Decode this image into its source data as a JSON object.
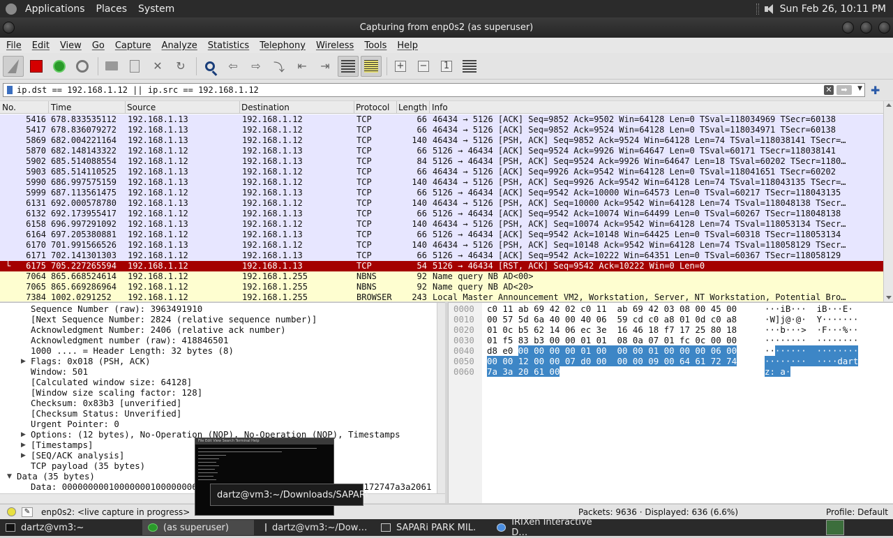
{
  "top_panel": {
    "menus": [
      "Applications",
      "Places",
      "System"
    ],
    "clock": "Sun Feb 26, 10:11 PM"
  },
  "window": {
    "title": "Capturing from enp0s2 (as superuser)"
  },
  "menubar": [
    "File",
    "Edit",
    "View",
    "Go",
    "Capture",
    "Analyze",
    "Statistics",
    "Telephony",
    "Wireless",
    "Tools",
    "Help"
  ],
  "toolbar_icons": [
    "shark-fin-start-icon",
    "stop-square-icon",
    "restart-fin-icon",
    "capture-options-gear-icon",
    "open-folder-icon",
    "save-file-icon",
    "close-file-icon",
    "reload-icon",
    "find-packet-icon",
    "go-back-icon",
    "go-forward-icon",
    "go-to-packet-icon",
    "go-first-icon",
    "go-last-icon",
    "autoscroll-icon",
    "colorize-icon",
    "zoom-in-icon",
    "zoom-out-icon",
    "normal-size-icon",
    "resize-columns-icon"
  ],
  "filter": {
    "value": "ip.dst == 192.168.1.12 || ip.src == 192.168.1.12"
  },
  "packet_list": {
    "columns": [
      "No.",
      "Time",
      "Source",
      "Destination",
      "Protocol",
      "Length",
      "Info"
    ],
    "rows": [
      {
        "no": "5416",
        "time": "678.833535112",
        "src": "192.168.1.13",
        "dst": "192.168.1.12",
        "proto": "TCP",
        "len": "66",
        "info": "46434 → 5126 [ACK] Seq=9852 Ack=9502 Win=64128 Len=0 TSval=118034969 TSecr=60138",
        "kind": "tcp"
      },
      {
        "no": "5417",
        "time": "678.836079272",
        "src": "192.168.1.13",
        "dst": "192.168.1.12",
        "proto": "TCP",
        "len": "66",
        "info": "46434 → 5126 [ACK] Seq=9852 Ack=9524 Win=64128 Len=0 TSval=118034971 TSecr=60138",
        "kind": "tcp"
      },
      {
        "no": "5869",
        "time": "682.004221164",
        "src": "192.168.1.13",
        "dst": "192.168.1.12",
        "proto": "TCP",
        "len": "140",
        "info": "46434 → 5126 [PSH, ACK] Seq=9852 Ack=9524 Win=64128 Len=74 TSval=118038141 TSecr=…",
        "kind": "tcp"
      },
      {
        "no": "5870",
        "time": "682.148143322",
        "src": "192.168.1.12",
        "dst": "192.168.1.13",
        "proto": "TCP",
        "len": "66",
        "info": "5126 → 46434 [ACK] Seq=9524 Ack=9926 Win=64647 Len=0 TSval=60171 TSecr=118038141",
        "kind": "tcp"
      },
      {
        "no": "5902",
        "time": "685.514088554",
        "src": "192.168.1.12",
        "dst": "192.168.1.13",
        "proto": "TCP",
        "len": "84",
        "info": "5126 → 46434 [PSH, ACK] Seq=9524 Ack=9926 Win=64647 Len=18 TSval=60202 TSecr=1180…",
        "kind": "tcp"
      },
      {
        "no": "5903",
        "time": "685.514110525",
        "src": "192.168.1.13",
        "dst": "192.168.1.12",
        "proto": "TCP",
        "len": "66",
        "info": "46434 → 5126 [ACK] Seq=9926 Ack=9542 Win=64128 Len=0 TSval=118041651 TSecr=60202",
        "kind": "tcp"
      },
      {
        "no": "5990",
        "time": "686.997575159",
        "src": "192.168.1.13",
        "dst": "192.168.1.12",
        "proto": "TCP",
        "len": "140",
        "info": "46434 → 5126 [PSH, ACK] Seq=9926 Ack=9542 Win=64128 Len=74 TSval=118043135 TSecr=…",
        "kind": "tcp"
      },
      {
        "no": "5999",
        "time": "687.113561475",
        "src": "192.168.1.12",
        "dst": "192.168.1.13",
        "proto": "TCP",
        "len": "66",
        "info": "5126 → 46434 [ACK] Seq=9542 Ack=10000 Win=64573 Len=0 TSval=60217 TSecr=118043135",
        "kind": "tcp"
      },
      {
        "no": "6131",
        "time": "692.000578780",
        "src": "192.168.1.13",
        "dst": "192.168.1.12",
        "proto": "TCP",
        "len": "140",
        "info": "46434 → 5126 [PSH, ACK] Seq=10000 Ack=9542 Win=64128 Len=74 TSval=118048138 TSecr…",
        "kind": "tcp"
      },
      {
        "no": "6132",
        "time": "692.173955417",
        "src": "192.168.1.12",
        "dst": "192.168.1.13",
        "proto": "TCP",
        "len": "66",
        "info": "5126 → 46434 [ACK] Seq=9542 Ack=10074 Win=64499 Len=0 TSval=60267 TSecr=118048138",
        "kind": "tcp"
      },
      {
        "no": "6158",
        "time": "696.997291092",
        "src": "192.168.1.13",
        "dst": "192.168.1.12",
        "proto": "TCP",
        "len": "140",
        "info": "46434 → 5126 [PSH, ACK] Seq=10074 Ack=9542 Win=64128 Len=74 TSval=118053134 TSecr…",
        "kind": "tcp"
      },
      {
        "no": "6164",
        "time": "697.205380881",
        "src": "192.168.1.12",
        "dst": "192.168.1.13",
        "proto": "TCP",
        "len": "66",
        "info": "5126 → 46434 [ACK] Seq=9542 Ack=10148 Win=64425 Len=0 TSval=60318 TSecr=118053134",
        "kind": "tcp"
      },
      {
        "no": "6170",
        "time": "701.991566526",
        "src": "192.168.1.13",
        "dst": "192.168.1.12",
        "proto": "TCP",
        "len": "140",
        "info": "46434 → 5126 [PSH, ACK] Seq=10148 Ack=9542 Win=64128 Len=74 TSval=118058129 TSecr…",
        "kind": "tcp"
      },
      {
        "no": "6171",
        "time": "702.141301303",
        "src": "192.168.1.12",
        "dst": "192.168.1.13",
        "proto": "TCP",
        "len": "66",
        "info": "5126 → 46434 [ACK] Seq=9542 Ack=10222 Win=64351 Len=0 TSval=60367 TSecr=118058129",
        "kind": "tcp"
      },
      {
        "no": "6175",
        "time": "705.227265594",
        "src": "192.168.1.12",
        "dst": "192.168.1.13",
        "proto": "TCP",
        "len": "54",
        "info": "5126 → 46434 [RST, ACK] Seq=9542 Ack=10222 Win=0 Len=0",
        "kind": "sel"
      },
      {
        "no": "7064",
        "time": "865.668524614",
        "src": "192.168.1.12",
        "dst": "192.168.1.255",
        "proto": "NBNS",
        "len": "92",
        "info": "Name query NB AD<00>",
        "kind": "nbns"
      },
      {
        "no": "7065",
        "time": "865.669286964",
        "src": "192.168.1.12",
        "dst": "192.168.1.255",
        "proto": "NBNS",
        "len": "92",
        "info": "Name query NB AD<20>",
        "kind": "nbns"
      },
      {
        "no": "7384",
        "time": "1002.0291252",
        "src": "192.168.1.12",
        "dst": "192.168.1.255",
        "proto": "BROWSER",
        "len": "243",
        "info": "Local Master Announcement VM2, Workstation, Server, NT Workstation, Potential Bro…",
        "kind": "nbns"
      }
    ]
  },
  "detail_tree": [
    {
      "text": "Sequence Number (raw): 3963491910",
      "indent": 1,
      "arrow": ""
    },
    {
      "text": "[Next Sequence Number: 2824    (relative sequence number)]",
      "indent": 1,
      "arrow": ""
    },
    {
      "text": "Acknowledgment Number: 2406    (relative ack number)",
      "indent": 1,
      "arrow": ""
    },
    {
      "text": "Acknowledgment number (raw): 418846501",
      "indent": 1,
      "arrow": ""
    },
    {
      "text": "1000 .... = Header Length: 32 bytes (8)",
      "indent": 1,
      "arrow": ""
    },
    {
      "text": "Flags: 0x018 (PSH, ACK)",
      "indent": 1,
      "arrow": "▶"
    },
    {
      "text": "Window: 501",
      "indent": 1,
      "arrow": ""
    },
    {
      "text": "[Calculated window size: 64128]",
      "indent": 1,
      "arrow": ""
    },
    {
      "text": "[Window size scaling factor: 128]",
      "indent": 1,
      "arrow": ""
    },
    {
      "text": "Checksum: 0x83b3 [unverified]",
      "indent": 1,
      "arrow": ""
    },
    {
      "text": "[Checksum Status: Unverified]",
      "indent": 1,
      "arrow": ""
    },
    {
      "text": "Urgent Pointer: 0",
      "indent": 1,
      "arrow": ""
    },
    {
      "text": "Options: (12 bytes), No-Operation (NOP), No-Operation (NOP), Timestamps",
      "indent": 1,
      "arrow": "▶"
    },
    {
      "text": "[Timestamps]",
      "indent": 1,
      "arrow": "▶"
    },
    {
      "text": "[SEQ/ACK analysis]",
      "indent": 1,
      "arrow": "▶"
    },
    {
      "text": "TCP payload (35 bytes)",
      "indent": 1,
      "arrow": ""
    },
    {
      "text": "Data (35 bytes)",
      "indent": 0,
      "arrow": "▼"
    },
    {
      "text": "Data: 0000000001000000010000000600000012000000007d00000000900646172747a3a2061",
      "indent": 1,
      "arrow": ""
    }
  ],
  "hex_dump": [
    {
      "offset": "0000",
      "hex_plain": "c0 11 ab 69 42 02 c0 11  ab 69 42 03 08 00 45 00",
      "hex_hl": "",
      "ascii_plain": "···iB···  iB···E·",
      "ascii_hl": ""
    },
    {
      "offset": "0010",
      "hex_plain": "00 57 5d 6a 40 00 40 06  59 cd c0 a8 01 0d c0 a8",
      "hex_hl": "",
      "ascii_plain": "·W]j@·@·  Y·······",
      "ascii_hl": ""
    },
    {
      "offset": "0020",
      "hex_plain": "01 0c b5 62 14 06 ec 3e  16 46 18 f7 17 25 80 18",
      "hex_hl": "",
      "ascii_plain": "···b···>  ·F···%··",
      "ascii_hl": ""
    },
    {
      "offset": "0030",
      "hex_plain": "01 f5 83 b3 00 00 01 01  08 0a 07 01 fc 0c 00 00",
      "hex_hl": "",
      "ascii_plain": "········  ········",
      "ascii_hl": ""
    },
    {
      "offset": "0040",
      "hex_plain": "d8 e0 ",
      "hex_hl": "00 00 00 00 01 00  00 00 01 00 00 00 06 00",
      "ascii_plain": "··",
      "ascii_hl": "······  ········"
    },
    {
      "offset": "0050",
      "hex_plain": "",
      "hex_hl": "00 00 12 00 00 07 d0 00  00 00 09 00 64 61 72 74",
      "ascii_plain": "",
      "ascii_hl": "········  ····dart"
    },
    {
      "offset": "0060",
      "hex_plain": "",
      "hex_hl": "7a 3a 20 61 00",
      "ascii_plain": "",
      "ascii_hl": "z: a·"
    }
  ],
  "statusbar": {
    "capture": "enp0s2: <live capture in progress>",
    "packets": "Packets: 9636 · Displayed: 636 (6.6%)",
    "profile": "Profile: Default"
  },
  "taskbar": [
    {
      "label": "dartz@vm3:~",
      "icon": "terminal-icon",
      "active": false
    },
    {
      "label": "(as superuser)",
      "icon": "wireshark-icon",
      "active": true
    },
    {
      "label": "dartz@vm3:~/Dow…",
      "icon": "terminal-icon",
      "active": false
    },
    {
      "label": "SAPARi PARK MIL.",
      "icon": "sapari-icon",
      "active": false
    },
    {
      "label": "IRIXen Interactive D…",
      "icon": "chrome-icon",
      "active": false
    }
  ],
  "tooltip": "dartz@vm3:~/Downloads/SAPARI",
  "colors": {
    "selected_row": "#a40000",
    "tcp_row": "#e7e6ff",
    "nbns_row": "#fefed0",
    "hex_highlight": "#3d86c6"
  }
}
